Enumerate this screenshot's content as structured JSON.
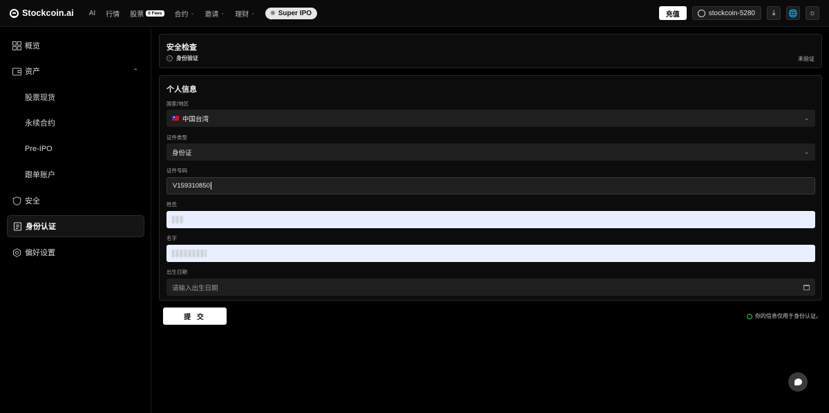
{
  "brand": {
    "name": "Stockcoin.ai"
  },
  "nav": {
    "items": [
      {
        "label": "AI",
        "has_dropdown": false
      },
      {
        "label": "行情",
        "has_dropdown": false
      },
      {
        "label": "股票",
        "has_dropdown": true,
        "badge": "0 Fees"
      },
      {
        "label": "合约",
        "has_dropdown": true
      },
      {
        "label": "邀请",
        "has_dropdown": true
      },
      {
        "label": "理财",
        "has_dropdown": true
      }
    ],
    "super_ipo": "Super IPO"
  },
  "header_actions": {
    "deposit": "充值",
    "account": "stockcoin-5280",
    "icons": [
      "download-icon",
      "globe-icon",
      "sun-icon"
    ]
  },
  "sidebar": {
    "items": [
      {
        "label": "概览",
        "icon": "dashboard-icon"
      },
      {
        "label": "资产",
        "icon": "wallet-icon",
        "expanded": true
      },
      {
        "label": "股票现货",
        "sub": true
      },
      {
        "label": "永续合约",
        "sub": true
      },
      {
        "label": "Pre-IPO",
        "sub": true
      },
      {
        "label": "跟单账户",
        "sub": true
      },
      {
        "label": "安全",
        "icon": "shield-icon"
      },
      {
        "label": "身份认证",
        "icon": "id-card-icon",
        "active": true
      },
      {
        "label": "偏好设置",
        "icon": "settings-icon"
      }
    ]
  },
  "security_check": {
    "title": "安全检查",
    "item_label": "身份验证",
    "status": "未验证"
  },
  "personal_info": {
    "title": "个人信息",
    "country_label": "国家/地区",
    "country_value": "中国台湾",
    "id_type_label": "证件类型",
    "id_type_value": "身份证",
    "id_number_label": "证件号码",
    "id_number_value": "V159310850",
    "surname_label": "姓氏",
    "given_name_label": "名字",
    "birthdate_label": "出生日期",
    "birthdate_placeholder": "请输入出生日期"
  },
  "submit_label": "提 交",
  "privacy_note": "你的信息仅用于身份认证。",
  "colors": {
    "background": "#000000",
    "card": "#0c0c0c",
    "field": "#1f1f1f",
    "autofill": "#e9efff",
    "success": "#3cc36b"
  }
}
